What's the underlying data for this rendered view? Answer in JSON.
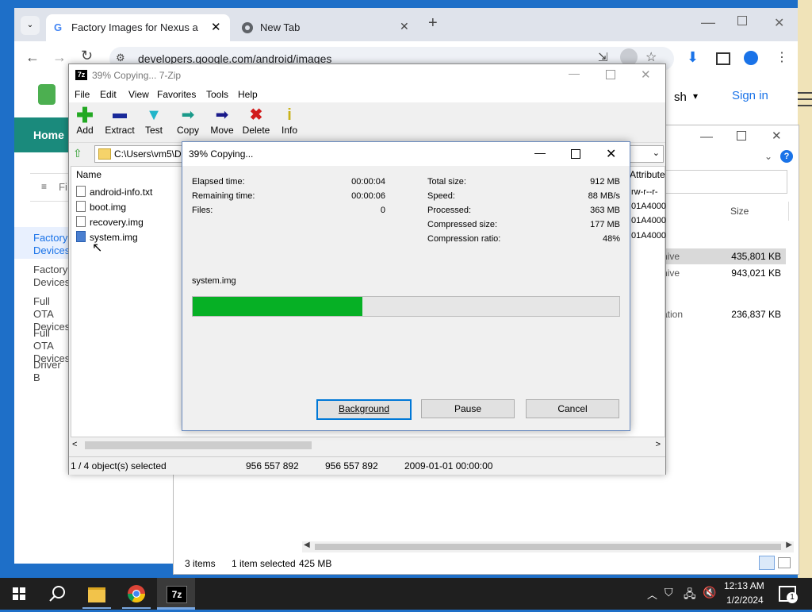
{
  "chrome": {
    "tabs": [
      {
        "label": "Factory Images for Nexus and P",
        "active": true
      },
      {
        "label": "New Tab",
        "active": false
      }
    ],
    "url": "developers.google.com/android/images",
    "site": {
      "header_right": "sh",
      "sign_in": "Sign in",
      "home": "Home",
      "filter_text": "Fi",
      "nav": [
        "Factory Devices",
        "Factory Devices",
        "Full OTA Devices",
        "Full OTA Devices",
        "Driver B"
      ]
    }
  },
  "explorer": {
    "columns": {
      "size": "Size",
      "attributes": "Attribute"
    },
    "rows": [
      {
        "type": "hive",
        "size": "435,801 KB"
      },
      {
        "type": "hive",
        "size": "943,021 KB"
      },
      {
        "type": "ation",
        "size": "236,837 KB"
      }
    ],
    "attr_rows": [
      "rw-r--r-",
      "01A4000",
      "01A4000",
      "01A4000"
    ],
    "status": {
      "items": "3 items",
      "selected": "1 item selected",
      "size": "425 MB"
    }
  },
  "zip": {
    "title": "39% Copying... 7-Zip",
    "menu": [
      "File",
      "Edit",
      "View",
      "Favorites",
      "Tools",
      "Help"
    ],
    "toolbar": [
      {
        "label": "Add",
        "icon": "plus-icon",
        "color": "#22a822"
      },
      {
        "label": "Extract",
        "icon": "minus-icon",
        "color": "#1a2a9a"
      },
      {
        "label": "Test",
        "icon": "check-icon",
        "color": "#21b5c9"
      },
      {
        "label": "Copy",
        "icon": "arrow-right-icon",
        "color": "#1a9a8a"
      },
      {
        "label": "Move",
        "icon": "arrow-right-icon",
        "color": "#1a1a8a"
      },
      {
        "label": "Delete",
        "icon": "x-icon",
        "color": "#d11a1a"
      },
      {
        "label": "Info",
        "icon": "info-icon",
        "color": "#c9b21a"
      }
    ],
    "path": "C:\\Users\\vm5\\D",
    "column_name": "Name",
    "files": [
      "android-info.txt",
      "boot.img",
      "recovery.img",
      "system.img"
    ],
    "status": [
      "1 / 4 object(s) selected",
      "956 557 892",
      "956 557 892",
      "2009-01-01 00:00:00"
    ]
  },
  "dialog": {
    "title": "39% Copying...",
    "left": [
      {
        "label": "Elapsed time:",
        "value": "00:00:04"
      },
      {
        "label": "Remaining time:",
        "value": "00:00:06"
      },
      {
        "label": "Files:",
        "value": "0"
      }
    ],
    "right": [
      {
        "label": "Total size:",
        "value": "912 MB"
      },
      {
        "label": "Speed:",
        "value": "88 MB/s"
      },
      {
        "label": "Processed:",
        "value": "363 MB"
      },
      {
        "label": "Compressed size:",
        "value": "177 MB"
      },
      {
        "label": "Compression ratio:",
        "value": "48%"
      }
    ],
    "current_file": "system.img",
    "progress": 0.398,
    "buttons": {
      "background": "Background",
      "pause": "Pause",
      "cancel": "Cancel"
    }
  },
  "taskbar": {
    "time": "12:13 AM",
    "date": "1/2/2024",
    "notifications": "1"
  }
}
